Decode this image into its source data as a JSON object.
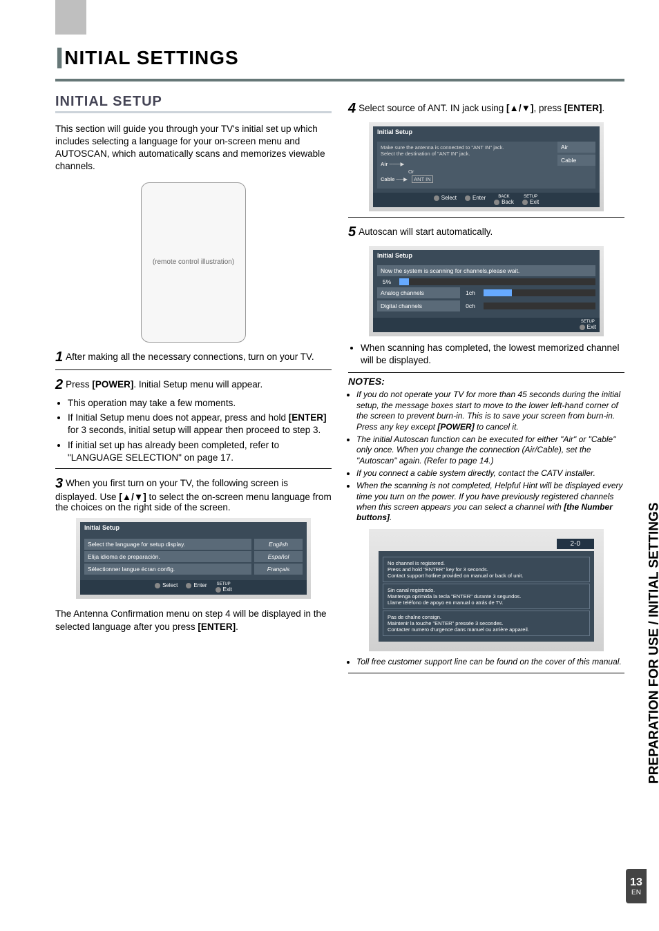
{
  "sidebar_text": "PREPARATION FOR USE / INITIAL SETTINGS",
  "page_number": "13",
  "page_lang": "EN",
  "chapter_title": "NITIAL SETTINGS",
  "chapter_initial": "I",
  "section_title": "INITIAL SETUP",
  "intro": "This section will guide you through your TV's initial set up which includes selecting a language for your on-screen menu and AUTOSCAN, which automatically scans and memorizes viewable channels.",
  "remote_placeholder": "(remote control illustration)",
  "steps": {
    "s1_num": "1",
    "s1": "After making all the necessary connections, turn on your TV.",
    "s2_num": "2",
    "s2": "Press [POWER]. Initial Setup menu will appear.",
    "s2_bullets": [
      "This operation may take a few moments.",
      "If Initial Setup menu does not appear, press and hold [ENTER] for 3 seconds, initial setup will appear then proceed to step 3.",
      "If initial set up has already been completed, refer to \"LANGUAGE SELECTION\" on page 17."
    ],
    "s3_num": "3",
    "s3": "When you first turn on your TV, the following screen is displayed. Use [▲/▼] to select the on-screen menu language from the choices on the right side of the screen.",
    "s3_after": "The Antenna Confirmation menu on step 4 will be displayed in the selected language after you press [ENTER].",
    "s4_num": "4",
    "s4": "Select source of ANT. IN jack using [▲/▼], press [ENTER].",
    "s5_num": "5",
    "s5": "Autoscan will start automatically.",
    "s5_bullet": "When scanning has completed, the lowest memorized channel will be displayed."
  },
  "osd_lang": {
    "title": "Initial Setup",
    "rows": [
      {
        "a": "Select the language for setup display.",
        "b": "English"
      },
      {
        "a": "Elija idioma de preparación.",
        "b": "Español"
      },
      {
        "a": "Sélectionner langue écran config.",
        "b": "Français"
      }
    ],
    "footer": [
      "Select",
      "Enter",
      "Exit"
    ],
    "footer_setup": "SETUP"
  },
  "osd_ant": {
    "title": "Initial Setup",
    "msg1": "Make sure the antenna is connected to \"ANT IN\" jack.",
    "msg2": "Select the destination of \"ANT IN\" jack.",
    "options": [
      "Air",
      "Cable"
    ],
    "diag": {
      "air": "Air",
      "cable": "Cable",
      "or": "Or",
      "antin": "ANT IN"
    },
    "footer": [
      "Select",
      "Enter",
      "Back",
      "Exit"
    ],
    "footer_back": "BACK",
    "footer_setup": "SETUP"
  },
  "osd_scan": {
    "title": "Initial Setup",
    "msg": "Now the system is scanning for channels,please wait.",
    "pct": "5%",
    "rows": [
      {
        "label": "Analog channels",
        "val": "1ch",
        "fill": 25
      },
      {
        "label": "Digital channels",
        "val": "0ch",
        "fill": 0
      }
    ],
    "footer_exit": "Exit",
    "footer_setup": "SETUP"
  },
  "notes_title": "NOTES:",
  "notes": [
    "If you do not operate your TV for more than 45 seconds during the initial setup, the message boxes start to move to the lower left-hand corner of the screen to prevent burn-in. This is to save your screen from burn-in. Press any key except [POWER] to cancel it.",
    "The initial Autoscan function can be executed for either \"Air\" or \"Cable\" only once. When you change the connection (Air/Cable), set the \"Autoscan\" again. (Refer to page 14.)",
    "If you connect a cable system directly, contact the CATV installer.",
    "When the scanning is not completed, Helpful Hint will be displayed every time you turn on the power. If you have previously registered channels when this screen appears you can select a channel with [the Number buttons]."
  ],
  "hint": {
    "badge": "2-0",
    "en": [
      "No channel is registered.",
      "Press and hold \"ENTER\" key for 3 seconds.",
      "Contact support hotline provided on manual or back of unit."
    ],
    "es": [
      "Sin canal registrado.",
      "Mantenga oprimida la tecla \"ENTER\" durante 3 segundos.",
      "Llame teléfono de apoyo en manual o atrás de TV."
    ],
    "fr": [
      "Pas de chaîne consign.",
      "Maintenir la touche \"ENTER\" pressée 3 secondes.",
      "Contacter numero d'urgence dans manuel ou arrière appareil."
    ]
  },
  "toll_free": "Toll free customer support line can be found on the cover of this manual."
}
